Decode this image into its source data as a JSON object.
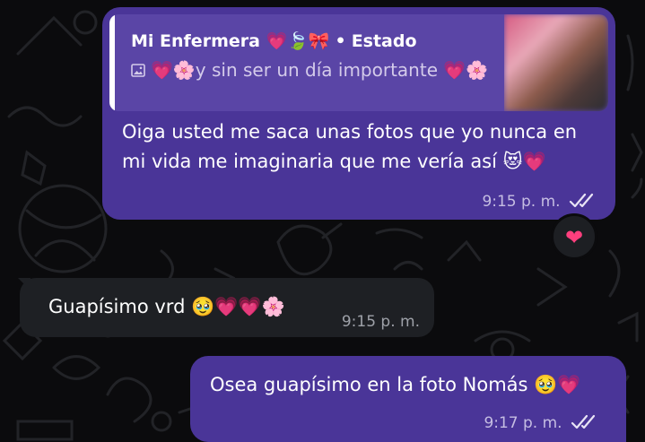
{
  "colors": {
    "outgoing_bubble": "#4a3598",
    "incoming_bubble": "#1e2024",
    "quote_background": "#5a45a6",
    "background": "#0b0b0d",
    "heart_reaction": "#ff3f7e"
  },
  "messages": [
    {
      "direction": "outgoing",
      "quote": {
        "author": "Mi Enfermera 💗🍃🎀",
        "separator": "•",
        "source": "Estado",
        "media_icon": "image-icon",
        "text": "💗🌸y sin ser un día importante 💗🌸"
      },
      "text": "Oiga usted me saca unas fotos que yo nunca en mi vida me imaginaria que me vería así 😻💗",
      "time": "9:15 p. m.",
      "status_icon": "double-check-icon",
      "reaction": "❤"
    },
    {
      "direction": "incoming",
      "text": "Guapísimo vrd 🥹💗💗🌸",
      "time": "9:15 p. m."
    },
    {
      "direction": "outgoing",
      "text": "Osea guapísimo en la foto Nomás 🥹💗",
      "time": "9:17 p. m.",
      "status_icon": "double-check-icon"
    }
  ]
}
